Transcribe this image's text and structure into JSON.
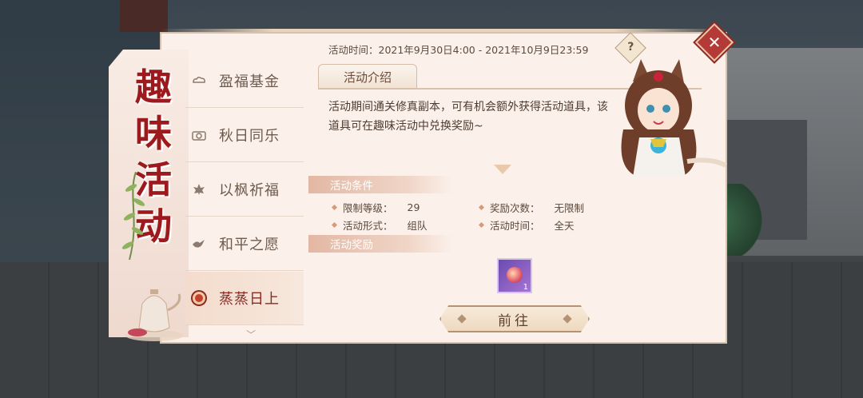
{
  "banner": {
    "title_chars": [
      "趣",
      "味",
      "活",
      "动"
    ]
  },
  "sidebar": {
    "items": [
      {
        "label": "盈福基金",
        "icon": "cloud-scroll-icon"
      },
      {
        "label": "秋日同乐",
        "icon": "camera-icon"
      },
      {
        "label": "以枫祈福",
        "icon": "maple-leaf-icon"
      },
      {
        "label": "和平之愿",
        "icon": "dove-icon"
      },
      {
        "label": "蒸蒸日上",
        "icon": "sun-disc-icon",
        "active": true
      }
    ],
    "more_arrow": "﹀"
  },
  "header": {
    "time_text": "活动时间：2021年9月30日4:00 - 2021年10月9日23:59",
    "help_label": "?",
    "close_label": "✕"
  },
  "intro": {
    "tab_label": "活动介绍",
    "text": "活动期间通关修真副本，可有机会额外获得活动道具，该道具可在趣味活动中兑换奖励~"
  },
  "conditions": {
    "header": "活动条件",
    "items": [
      {
        "key": "限制等级：",
        "value": "29"
      },
      {
        "key": "奖励次数：",
        "value": "无限制"
      },
      {
        "key": "活动形式：",
        "value": "组队"
      },
      {
        "key": "活动时间：",
        "value": "全天"
      }
    ]
  },
  "rewards": {
    "header": "活动奖励",
    "items": [
      {
        "count": "1",
        "icon": "treasure-item-icon"
      }
    ]
  },
  "actions": {
    "go_label": "前往"
  },
  "colors": {
    "accent_red": "#9c1a1e",
    "panel_bg": "#fbf1ea",
    "section_header": "#e3b7a4"
  }
}
